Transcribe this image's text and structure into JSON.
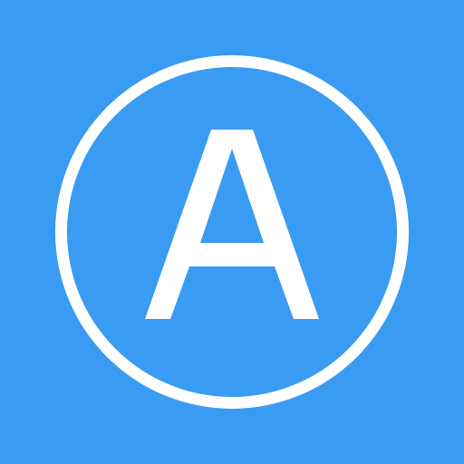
{
  "icon": {
    "letter": "A",
    "background_color": "#3a9bf2",
    "foreground_color": "#ffffff",
    "shape": "circle-outline"
  }
}
